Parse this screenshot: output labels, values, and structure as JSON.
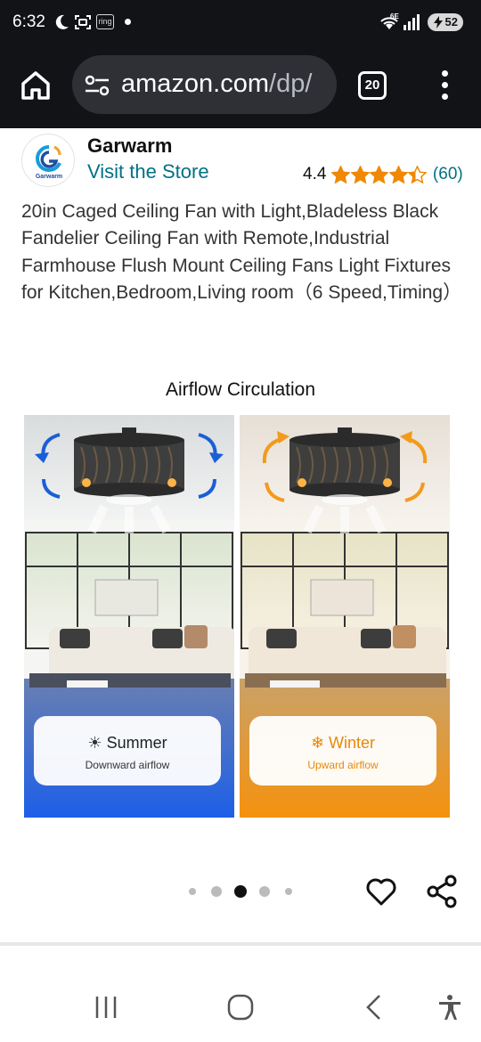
{
  "status_bar": {
    "time": "6:32",
    "ring_label": "ring",
    "network_label": "6E",
    "battery": "52",
    "icons": [
      "moon-icon",
      "screen-scan-icon",
      "ring-app-icon",
      "notification-dot-icon",
      "wifi-icon",
      "signal-icon",
      "battery-icon"
    ]
  },
  "browser": {
    "url_host": "amazon.com",
    "url_path": "/dp/",
    "tab_count": "20",
    "icons": [
      "home-icon",
      "site-settings-icon",
      "tabs-icon",
      "more-vert-icon"
    ]
  },
  "product": {
    "brand": "Garwarm",
    "logo_text": "Garwarm",
    "visit_store": "Visit the Store",
    "rating_value": "4.4",
    "rating_stars": 4.4,
    "rating_count": "(60)",
    "title": "20in Caged Ceiling Fan with Light,Bladeless Black Fandelier Ceiling Fan with Remote,Industrial Farmhouse Flush Mount Ceiling Fans Light Fixtures for Kitchen,Bedroom,Living room（6 Speed,Timing）"
  },
  "gallery": {
    "heading": "Airflow Circulation",
    "summer": {
      "title": "Summer",
      "subtitle": "Downward airflow"
    },
    "winter": {
      "title": "Winter",
      "subtitle": "Upward airflow"
    },
    "image_count": 5,
    "active_index": 2
  },
  "colors": {
    "link": "#007185",
    "star": "#f08804",
    "summer_blue": "#1a5fd6",
    "winter_orange": "#f39a1c",
    "chrome": "#121317"
  }
}
